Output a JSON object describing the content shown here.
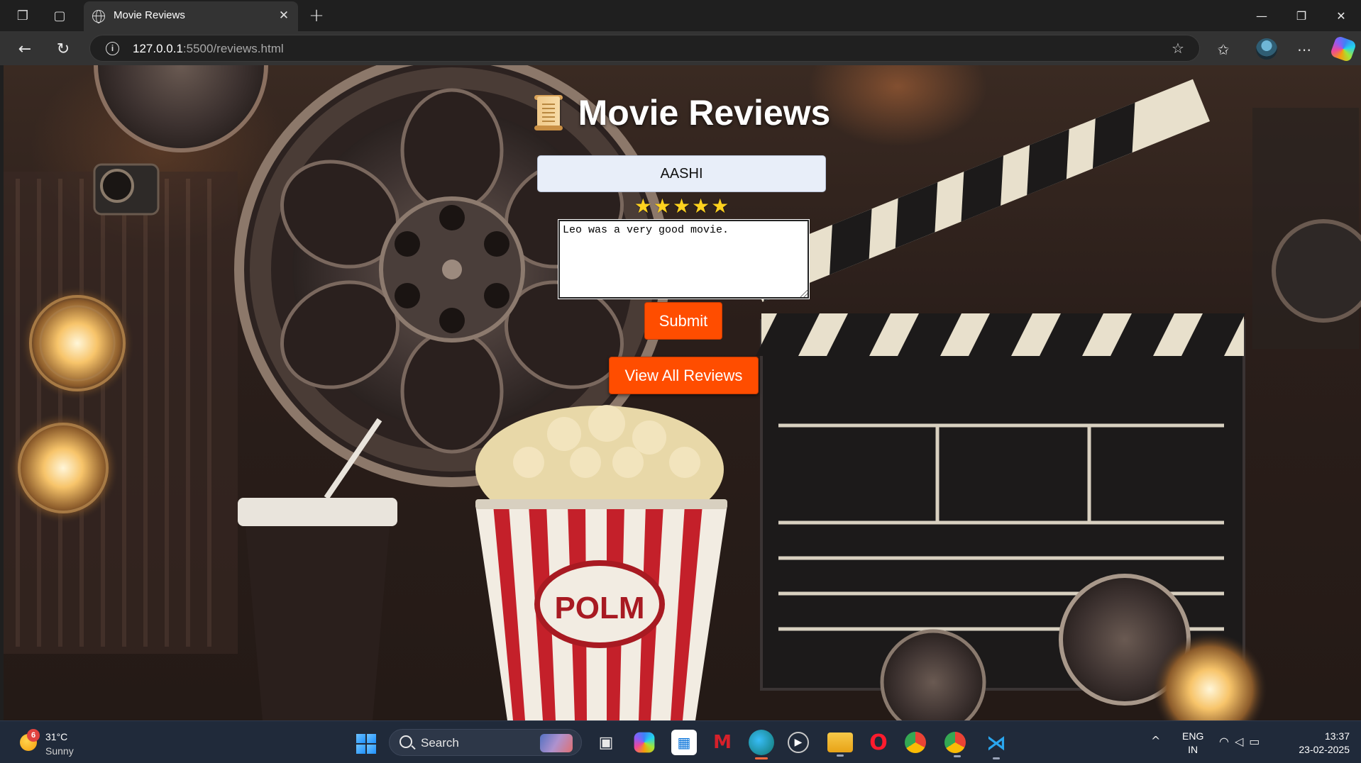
{
  "browser": {
    "tab_title": "Movie Reviews",
    "url_host": "127.0.0.1",
    "url_rest": ":5500/reviews.html"
  },
  "page": {
    "title": "Movie Reviews",
    "title_icon": "scroll-icon",
    "name_value": "AASHI",
    "rating": 5,
    "rating_stars": "★★★★★",
    "review_text": "Leo was a very good movie.",
    "submit_label": "Submit",
    "view_all_label": "View All Reviews"
  },
  "taskbar": {
    "weather_badge": "6",
    "weather_temp": "31°C",
    "weather_condition": "Sunny",
    "search_label": "Search",
    "lang_line1": "ENG",
    "lang_line2": "IN",
    "time": "13:37",
    "date": "23-02-2025",
    "apps": [
      "file-explorer-icon",
      "copilot-icon",
      "store-icon",
      "mcafee-icon",
      "edge-icon",
      "media-player-icon",
      "folder-icon",
      "opera-icon",
      "chrome-icon",
      "chrome-profile-icon",
      "vscode-icon"
    ]
  },
  "colors": {
    "accent_button": "#ff4d00",
    "star": "#ffd21f",
    "input_bg": "#e8eef9"
  }
}
